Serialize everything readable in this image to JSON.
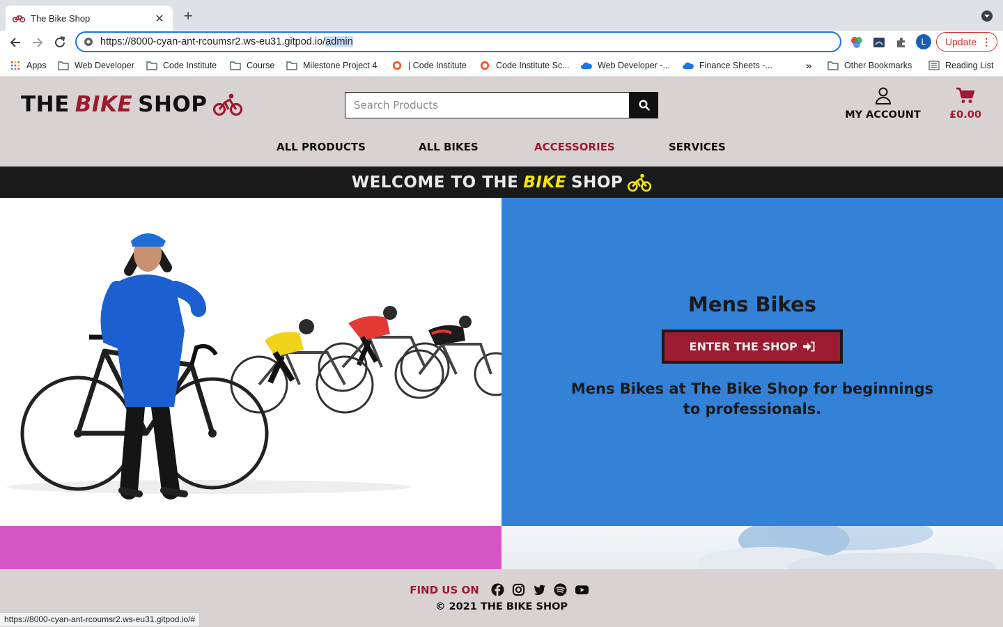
{
  "browser": {
    "tab_title": "The Bike Shop",
    "new_tab": "+",
    "url_prefix": "https://8000-cyan-ant-rcoumsr2.ws-eu31.gitpod.io/",
    "url_selected": "admin",
    "profile_initial": "L",
    "update_label": "Update",
    "bookmarks": [
      {
        "label": "Apps",
        "icon": "apps-grid-icon"
      },
      {
        "label": "Web Developer",
        "icon": "folder-icon"
      },
      {
        "label": "Code Institute",
        "icon": "folder-icon"
      },
      {
        "label": "Course",
        "icon": "folder-icon"
      },
      {
        "label": "Milestone Project 4",
        "icon": "folder-icon"
      },
      {
        "label": "| Code Institute",
        "icon": "code-institute-icon"
      },
      {
        "label": "Code Institute Sc...",
        "icon": "code-institute-icon"
      },
      {
        "label": "Web Developer -...",
        "icon": "onedrive-icon"
      },
      {
        "label": "Finance Sheets -...",
        "icon": "onedrive-icon"
      },
      {
        "label": "»",
        "icon": "overflow-icon"
      },
      {
        "label": "Other Bookmarks",
        "icon": "folder-icon"
      },
      {
        "label": "Reading List",
        "icon": "reading-list-icon"
      }
    ],
    "status_url": "https://8000-cyan-ant-rcoumsr2.ws-eu31.gitpod.io/#"
  },
  "header": {
    "logo": {
      "the": "THE",
      "bike": "BIKE",
      "shop": "SHOP"
    },
    "search_placeholder": "Search Products",
    "account_label": "MY ACCOUNT",
    "cart_total": "£0.00",
    "nav": [
      {
        "label": "ALL PRODUCTS",
        "active": false
      },
      {
        "label": "ALL BIKES",
        "active": false
      },
      {
        "label": "ACCESSORIES",
        "active": true
      },
      {
        "label": "SERVICES",
        "active": false
      }
    ]
  },
  "banner": {
    "welcome": "WELCOME TO THE",
    "bike": "BIKE",
    "shop": "SHOP"
  },
  "hero": {
    "title": "Mens Bikes",
    "button_label": "ENTER THE SHOP",
    "description": "Mens Bikes at The Bike Shop for beginnings to professionals."
  },
  "footer": {
    "find_us": "FIND US ON",
    "social": [
      "facebook-icon",
      "instagram-icon",
      "twitter-icon",
      "spotify-icon",
      "youtube-icon"
    ],
    "copyright": "© 2021 THE BIKE SHOP"
  },
  "colors": {
    "brand_red": "#9b1b30",
    "header_bg": "#d9d2d2",
    "hero_blue": "#3481d8",
    "banner_yellow": "#f5e800",
    "pink": "#d655c6"
  }
}
